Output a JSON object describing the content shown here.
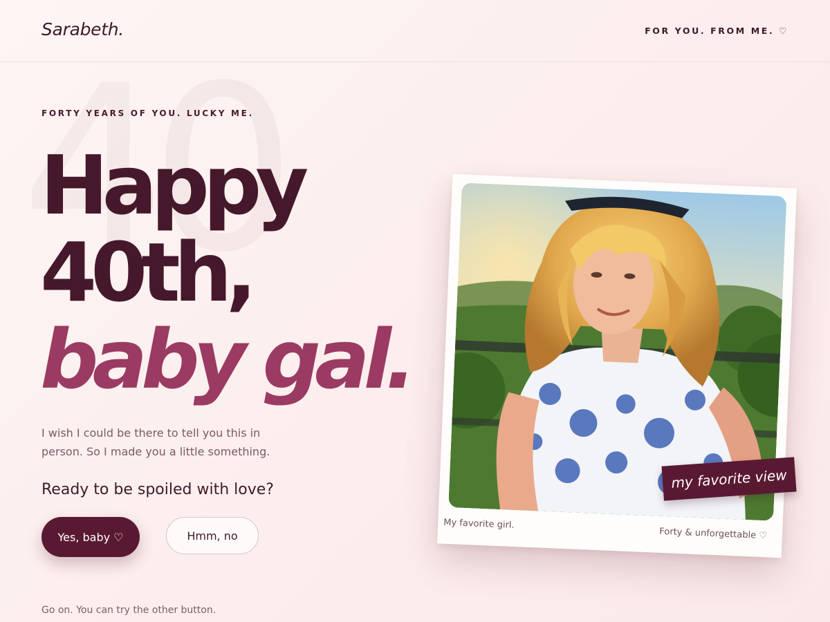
{
  "header": {
    "logo": "Sarabeth.",
    "tagline": "FOR YOU. FROM ME. ♡"
  },
  "hero": {
    "ghost_number": "40",
    "eyebrow": "FORTY YEARS OF YOU. LUCKY ME.",
    "headline_line1": "Happy",
    "headline_line2": "40th,",
    "headline_line3": "baby gal.",
    "intro": "I wish I could be there to tell you this in person. So I made you a little something.",
    "question": "Ready to be spoiled with love?",
    "yes_button": "Yes, baby ♡",
    "no_button": "Hmm, no",
    "hint": "Go on. You can try the other button."
  },
  "polaroid": {
    "photo_subject": "woman with long wavy blonde hair in floral dress at sunset",
    "caption_left": "My favorite girl.",
    "caption_right": "Forty & unforgettable ♡",
    "sticker": "my favorite view"
  },
  "colors": {
    "accent_dark": "#5a1932",
    "accent_rose": "#9b3a62",
    "background": "#fcefee"
  }
}
